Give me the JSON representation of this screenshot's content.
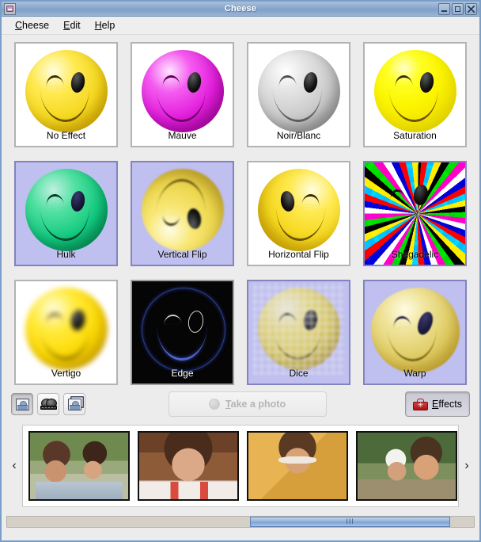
{
  "window": {
    "title": "Cheese",
    "icon": "cheese-app-icon",
    "controls": {
      "minimize": "minimize",
      "maximize": "maximize",
      "close": "close"
    }
  },
  "menubar": {
    "items": [
      {
        "label": "Cheese",
        "mnemonic": "C"
      },
      {
        "label": "Edit",
        "mnemonic": "E"
      },
      {
        "label": "Help",
        "mnemonic": "H"
      }
    ]
  },
  "effects": {
    "rows": [
      [
        {
          "label": "No Effect",
          "selected": false,
          "style": "plain"
        },
        {
          "label": "Mauve",
          "selected": false,
          "style": "mauve"
        },
        {
          "label": "Noir/Blanc",
          "selected": false,
          "style": "grey"
        },
        {
          "label": "Saturation",
          "selected": false,
          "style": "saturation"
        }
      ],
      [
        {
          "label": "Hulk",
          "selected": true,
          "style": "hulk"
        },
        {
          "label": "Vertical Flip",
          "selected": true,
          "style": "vertical-flip"
        },
        {
          "label": "Horizontal Flip",
          "selected": false,
          "style": "horizontal-flip"
        },
        {
          "label": "Shagadelic",
          "selected": true,
          "style": "shagadelic"
        }
      ],
      [
        {
          "label": "Vertigo",
          "selected": false,
          "style": "vertigo"
        },
        {
          "label": "Edge",
          "selected": false,
          "style": "edge"
        },
        {
          "label": "Dice",
          "selected": true,
          "style": "dice"
        },
        {
          "label": "Warp",
          "selected": true,
          "style": "warp"
        }
      ]
    ]
  },
  "toolbar": {
    "modes": [
      {
        "name": "photo-mode",
        "icon": "photo-icon",
        "active": true
      },
      {
        "name": "video-mode",
        "icon": "video-icon",
        "active": false
      },
      {
        "name": "burst-mode",
        "icon": "burst-icon",
        "active": false
      }
    ],
    "take_photo": {
      "label": "Take a photo",
      "mnemonic": "T",
      "enabled": false,
      "icon": "shutter-dot-icon"
    },
    "effects": {
      "label": "Effects",
      "mnemonic": "E",
      "pressed": true,
      "icon": "toolbox-icon"
    }
  },
  "thumbnails": {
    "prev_arrow": "‹",
    "next_arrow": "›",
    "items": [
      {
        "name": "photo-thumbnail-1",
        "caption": "two girls smiling outdoors"
      },
      {
        "name": "photo-thumbnail-2",
        "caption": "toddler laughing close-up"
      },
      {
        "name": "photo-thumbnail-3",
        "caption": "girl wearing white sunglasses"
      },
      {
        "name": "photo-thumbnail-4",
        "caption": "two girls one in white hat"
      }
    ]
  },
  "scrollbar": {
    "grip": "III",
    "thumb_left_pct": 52,
    "thumb_width_pct": 43
  },
  "colors": {
    "titlebar": "#8aa8cd",
    "background": "#ececec",
    "selected_tile": "#bfbff0",
    "selected_border": "#8383bd",
    "scroll_thumb": "#8fb0da",
    "effects_red": "#c02020"
  }
}
